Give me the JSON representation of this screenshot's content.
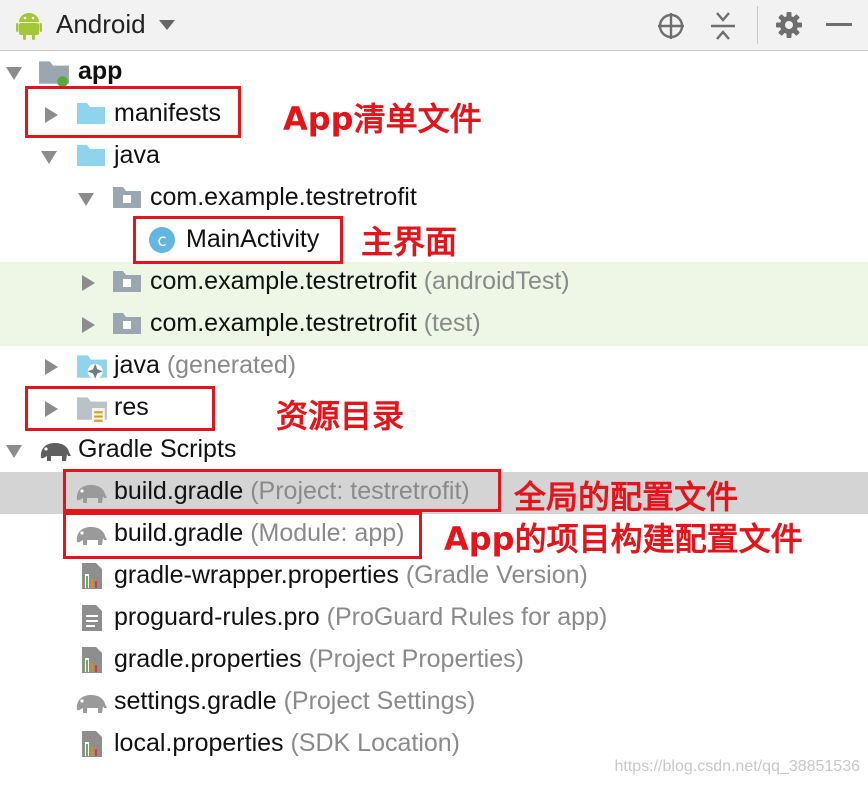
{
  "toolbar": {
    "view_mode": "Android",
    "icons": [
      "android-icon",
      "chevron-down-icon",
      "locate-icon",
      "collapse-all-icon",
      "gear-icon",
      "minimize-icon"
    ]
  },
  "tree": {
    "app": "app",
    "manifests": "manifests",
    "java": "java",
    "pkg_main": "com.example.testretrofit",
    "main_activity": "MainActivity",
    "pkg_android_test": "com.example.testretrofit",
    "pkg_android_test_hint": "(androidTest)",
    "pkg_test": "com.example.testretrofit",
    "pkg_test_hint": "(test)",
    "java_generated": "java",
    "java_generated_hint": "(generated)",
    "res": "res",
    "gradle_scripts": "Gradle Scripts",
    "build_gradle_project": "build.gradle",
    "build_gradle_project_hint": "(Project: testretrofit)",
    "build_gradle_module": "build.gradle",
    "build_gradle_module_hint": "(Module: app)",
    "wrapper_props": "gradle-wrapper.properties",
    "wrapper_props_hint": "(Gradle Version)",
    "proguard": "proguard-rules.pro",
    "proguard_hint": "(ProGuard Rules for app)",
    "gradle_props": "gradle.properties",
    "gradle_props_hint": "(Project Properties)",
    "settings_gradle": "settings.gradle",
    "settings_gradle_hint": "(Project Settings)",
    "local_props": "local.properties",
    "local_props_hint": "(SDK Location)"
  },
  "annotations": {
    "manifests": "App清单文件",
    "main_activity": "主界面",
    "res": "资源目录",
    "project_gradle": "全局的配置文件",
    "module_gradle": "App的项目构建配置文件"
  },
  "watermark": "https://blog.csdn.net/qq_38851536",
  "colors": {
    "annotation_red": "#e5141b",
    "folder_blue": "#8fd3ec",
    "package_gray": "#9aa7b0",
    "green_row": "#eef7e6",
    "selected_row": "#d4d4d4",
    "android_green": "#a4c639"
  }
}
